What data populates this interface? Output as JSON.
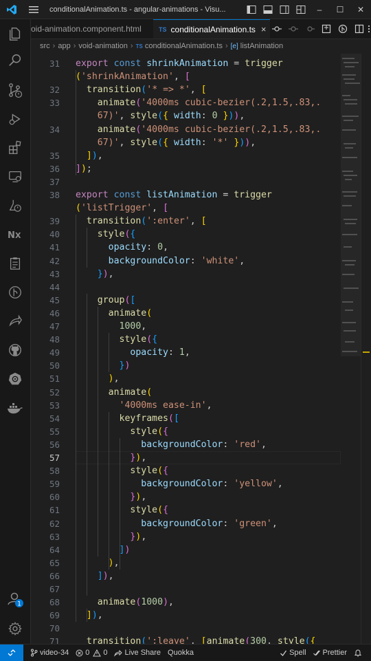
{
  "window": {
    "title": "conditionalAnimation.ts - angular-animations - Visu...",
    "controls": {
      "minimize": "–",
      "maximize": "☐",
      "close": "✕"
    }
  },
  "tabs": [
    {
      "label": "void-animation.component.html",
      "active": false,
      "visible_text": "oid-animation.component.html"
    },
    {
      "label": "conditionalAnimation.ts",
      "active": true,
      "badge": "TS",
      "close": "×"
    }
  ],
  "breadcrumb": {
    "parts": [
      "src",
      "app",
      "void-animation"
    ],
    "separator": "›",
    "file": "conditionalAnimation.ts",
    "file_badge": "TS",
    "symbol_icon": "[e]",
    "symbol": "listAnimation"
  },
  "editor": {
    "current_line": "57",
    "lines": [
      {
        "n": "31",
        "tokens": [
          [
            "kw2",
            "export "
          ],
          [
            "kw",
            "const "
          ],
          [
            "id",
            "shrinkAnimation"
          ],
          [
            "",
            ""
          ],
          [
            "",
            "",
            " "
          ],
          [
            "",
            ""
          ]
        ]
      }
    ]
  },
  "status": {
    "branch": "video-34",
    "errors": "0",
    "warnings": "0",
    "live_share": "Live Share",
    "quokka": "Quokka",
    "spell": "Spell",
    "prettier": "Prettier",
    "notification_count": "1"
  },
  "colors": {
    "accent": "#0078d4",
    "keyword": "#569cd6",
    "control_keyword": "#c586c0",
    "variable": "#9cdcfe",
    "function": "#dcdcaa",
    "string": "#ce9178",
    "number": "#b5cea8",
    "bracket1": "#ffd700",
    "bracket2": "#da70d6",
    "bracket3": "#179fff"
  },
  "icons": {
    "activity_bar": [
      "explorer-icon",
      "search-icon",
      "source-control-icon",
      "run-debug-icon",
      "extensions-icon",
      "remote-explorer-icon",
      "testing-icon",
      "nx-console-icon",
      "notes-icon",
      "git-graph-icon",
      "live-share-icon",
      "github-icon",
      "kubernetes-icon",
      "docker-icon"
    ],
    "bottom": [
      "account-icon",
      "settings-gear-icon"
    ]
  }
}
